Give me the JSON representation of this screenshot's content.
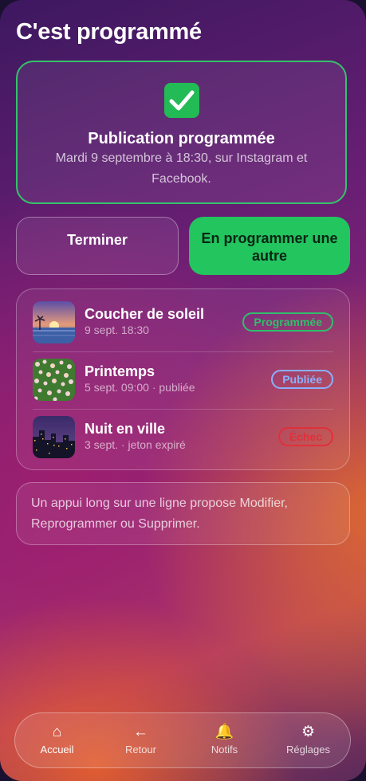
{
  "page": {
    "title": "C'est programmé"
  },
  "confirmation": {
    "title": "Publication programmée",
    "subtitle": "Mardi 9 septembre à 18:30, sur Instagram et Facebook.",
    "icon": "check-mark-button-icon"
  },
  "actions": {
    "done_label": "Terminer",
    "again_label": "En programmer une autre"
  },
  "posts": [
    {
      "title": "Coucher de soleil",
      "meta": "9 sept. 18:30",
      "status": "Programmée",
      "status_color": "#2fbf6a",
      "thumb": "sunset"
    },
    {
      "title": "Printemps",
      "meta": "5 sept. 09:00 · publiée",
      "status": "Publiée",
      "status_color": "#8ab0ff",
      "thumb": "flowers"
    },
    {
      "title": "Nuit en ville",
      "meta": "3 sept. · jeton expiré",
      "status": "Échec",
      "status_color": "#e0303a",
      "thumb": "city-night"
    }
  ],
  "hint": {
    "text": "Un appui long sur une ligne propose Modifier, Reprogrammer ou Supprimer."
  },
  "tabs": [
    {
      "label": "Accueil",
      "icon": "home-icon",
      "glyph": "⌂"
    },
    {
      "label": "Retour",
      "icon": "back-arrow-icon",
      "glyph": "←"
    },
    {
      "label": "Notifs",
      "icon": "bell-icon",
      "glyph": "🔔"
    },
    {
      "label": "Réglages",
      "icon": "gear-icon",
      "glyph": "⚙"
    }
  ],
  "colors": {
    "accent": "#22c55e"
  }
}
